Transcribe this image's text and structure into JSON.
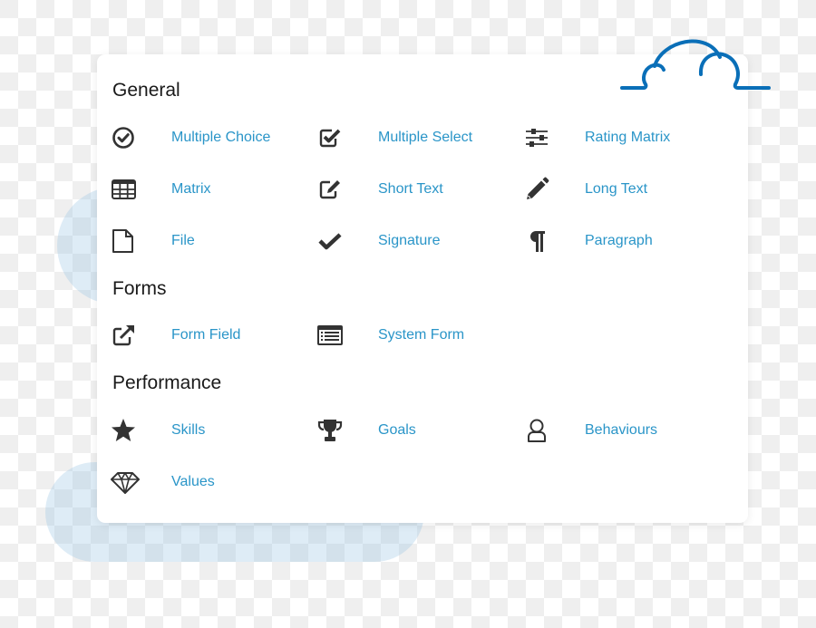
{
  "accent_color": "#2a95c8",
  "cloud_color": "#0a6fb8",
  "sections": [
    {
      "title": "General",
      "items": [
        {
          "label": "Multiple Choice",
          "icon": "circle-check-icon"
        },
        {
          "label": "Multiple Select",
          "icon": "checkbox-checked-icon"
        },
        {
          "label": "Rating Matrix",
          "icon": "sliders-icon"
        },
        {
          "label": "Matrix",
          "icon": "table-icon"
        },
        {
          "label": "Short Text",
          "icon": "edit-square-icon"
        },
        {
          "label": "Long Text",
          "icon": "pencil-icon"
        },
        {
          "label": "File",
          "icon": "file-icon"
        },
        {
          "label": "Signature",
          "icon": "check-icon"
        },
        {
          "label": "Paragraph",
          "icon": "paragraph-icon"
        }
      ]
    },
    {
      "title": "Forms",
      "items": [
        {
          "label": "Form Field",
          "icon": "external-link-icon"
        },
        {
          "label": "System Form",
          "icon": "list-alt-icon"
        }
      ]
    },
    {
      "title": "Performance",
      "items": [
        {
          "label": "Skills",
          "icon": "star-icon"
        },
        {
          "label": "Goals",
          "icon": "trophy-icon"
        },
        {
          "label": "Behaviours",
          "icon": "user-icon"
        },
        {
          "label": "Values",
          "icon": "diamond-icon"
        }
      ]
    }
  ]
}
